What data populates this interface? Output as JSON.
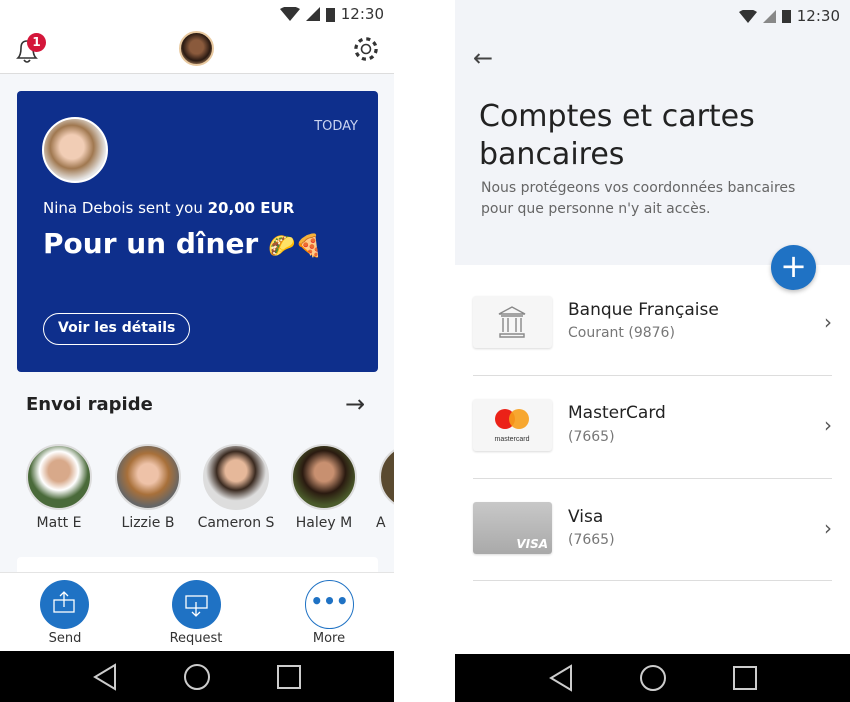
{
  "status_bar": {
    "time": "12:30"
  },
  "home": {
    "notification_count": "1",
    "card": {
      "date": "TODAY",
      "sender_line": "Nina Debois sent you",
      "amount": "20,00 EUR",
      "message": "Pour un dîner",
      "emoji": "🌮🍕",
      "details_button": "Voir les détails",
      "background": "#0e2f8c"
    },
    "quick_send": {
      "title": "Envoi rapide",
      "contacts": [
        {
          "name": "Matt E"
        },
        {
          "name": "Lizzie B"
        },
        {
          "name": "Cameron S"
        },
        {
          "name": "Haley M"
        },
        {
          "name": "A"
        }
      ]
    },
    "actions": [
      {
        "label": "Send",
        "icon": "send-money-icon"
      },
      {
        "label": "Request",
        "icon": "request-money-icon"
      },
      {
        "label": "More",
        "icon": "more-dots-icon"
      }
    ],
    "accent": "#1f72c4"
  },
  "accounts": {
    "title": "Comptes et cartes bancaires",
    "subtitle": "Nous protégeons vos coordonnées bancaires pour que personne n'y ait accès.",
    "items": [
      {
        "name": "Banque Française",
        "detail": "Courant (9876)",
        "icon": "bank-icon"
      },
      {
        "name": "MasterCard",
        "detail": "(7665)",
        "icon": "mastercard-logo",
        "logo_text": "mastercard"
      },
      {
        "name": "Visa",
        "detail": "(7665)",
        "icon": "visa-card",
        "logo_text": "VISA"
      }
    ]
  }
}
